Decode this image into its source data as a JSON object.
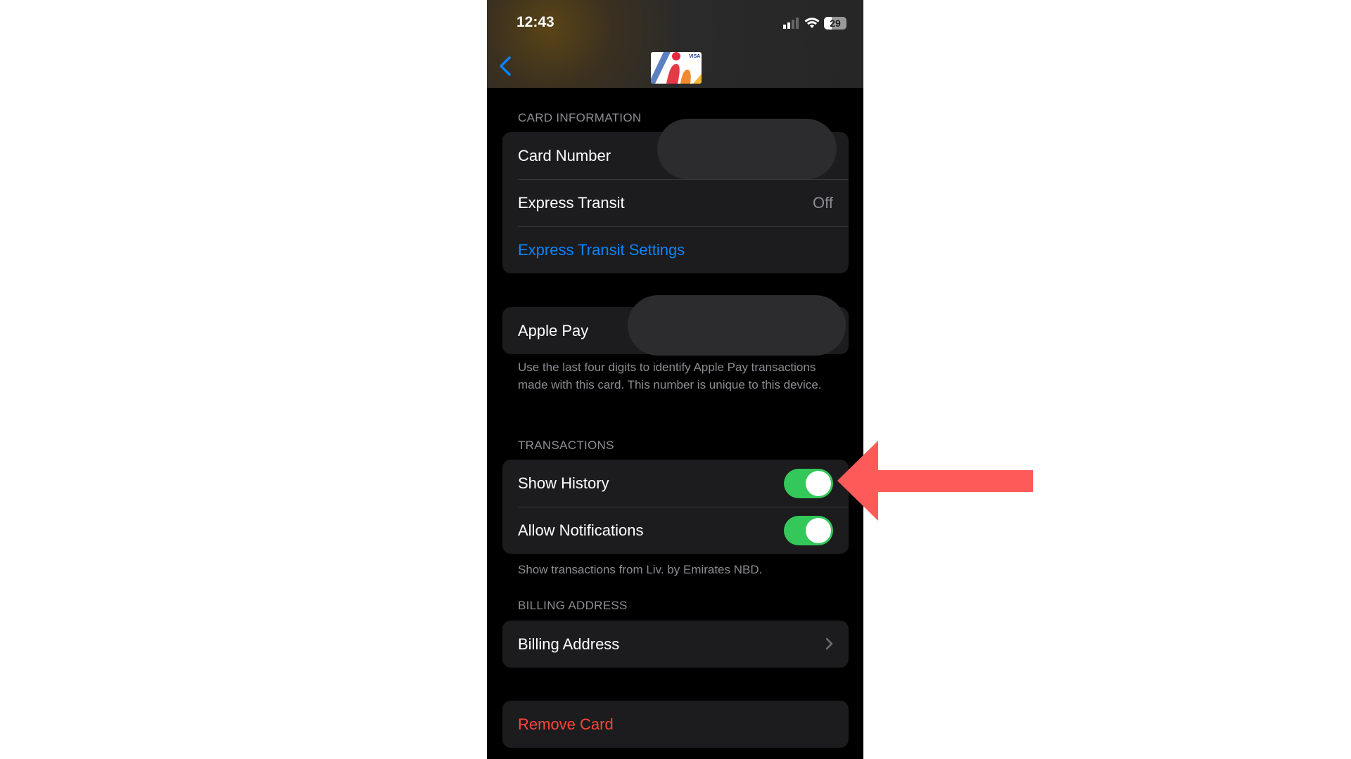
{
  "status_bar": {
    "time": "12:43",
    "battery": "29"
  },
  "nav": {
    "back_icon": "chevron-left-icon",
    "card_brand": "VISA"
  },
  "card_information": {
    "header": "CARD INFORMATION",
    "card_number_label": "Card Number",
    "express_transit_label": "Express Transit",
    "express_transit_value": "Off",
    "express_transit_settings": "Express Transit Settings"
  },
  "apple_pay": {
    "label": "Apple Pay",
    "footer": "Use the last four digits to identify Apple Pay transactions made with this card. This number is unique to this device."
  },
  "transactions": {
    "header": "TRANSACTIONS",
    "show_history": "Show History",
    "show_history_on": true,
    "allow_notifications": "Allow Notifications",
    "allow_notifications_on": true,
    "footer": "Show transactions from Liv. by Emirates NBD."
  },
  "billing": {
    "header": "BILLING ADDRESS",
    "label": "Billing Address"
  },
  "remove_card": "Remove Card",
  "colors": {
    "accent": "#0a84ff",
    "toggle_on": "#34c759",
    "destructive": "#ff453a",
    "annotation_arrow": "#ff5a5a"
  }
}
